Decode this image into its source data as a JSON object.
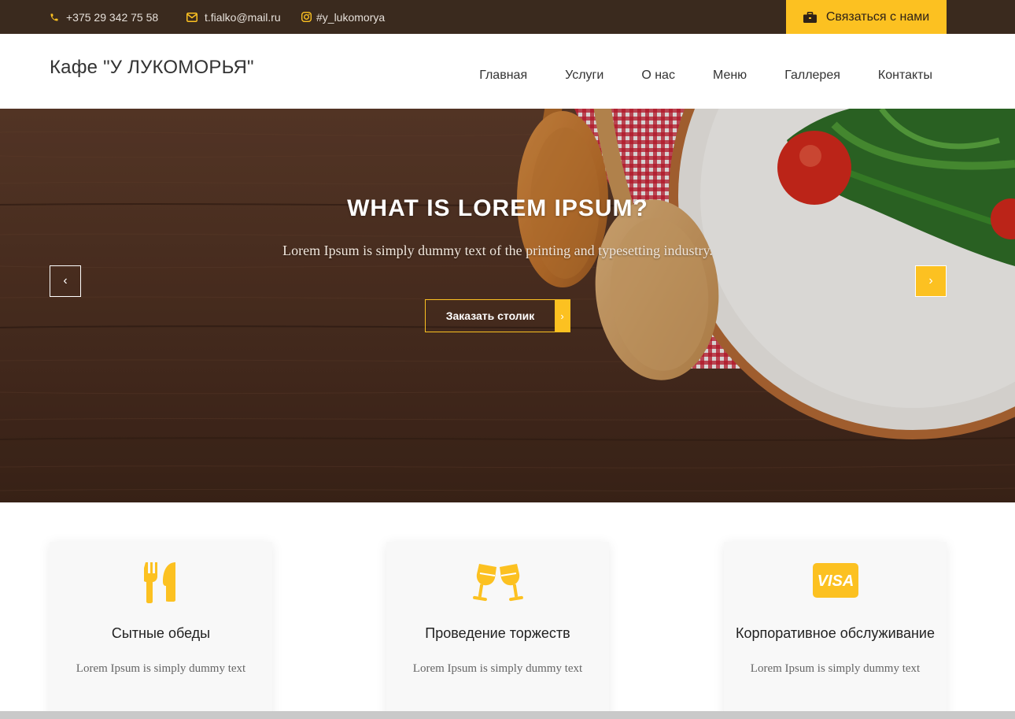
{
  "topbar": {
    "phone": "+375 29 342 75 58",
    "email": "t.fialko@mail.ru",
    "instagram": "#y_lukomorya",
    "contact_button": "Связаться с нами"
  },
  "header": {
    "logo": "Кафе \"У ЛУКОМОРЬЯ\"",
    "nav": [
      "Главная",
      "Услуги",
      "О нас",
      "Меню",
      "Галлерея",
      "Контакты"
    ]
  },
  "hero": {
    "title": "WHAT IS LOREM IPSUM?",
    "subtitle": "Lorem Ipsum is simply dummy text of the printing and typesetting industry.",
    "button": "Заказать столик",
    "prev_arrow": "‹",
    "next_arrow": "›",
    "button_chevron": "›"
  },
  "cards": [
    {
      "icon": "fork-knife-icon",
      "title": "Сытные обеды",
      "text": "Lorem Ipsum is simply dummy text"
    },
    {
      "icon": "glasses-cheers-icon",
      "title": "Проведение торжеств",
      "text": "Lorem Ipsum is simply dummy text"
    },
    {
      "icon": "visa-card-icon",
      "title": "Корпоративное обслуживание",
      "text": "Lorem Ipsum is simply dummy text",
      "icon_text": "VISA"
    }
  ],
  "colors": {
    "accent": "#fcc121",
    "topbar_bg": "#3a2a1e",
    "wood": "#5a3826"
  }
}
